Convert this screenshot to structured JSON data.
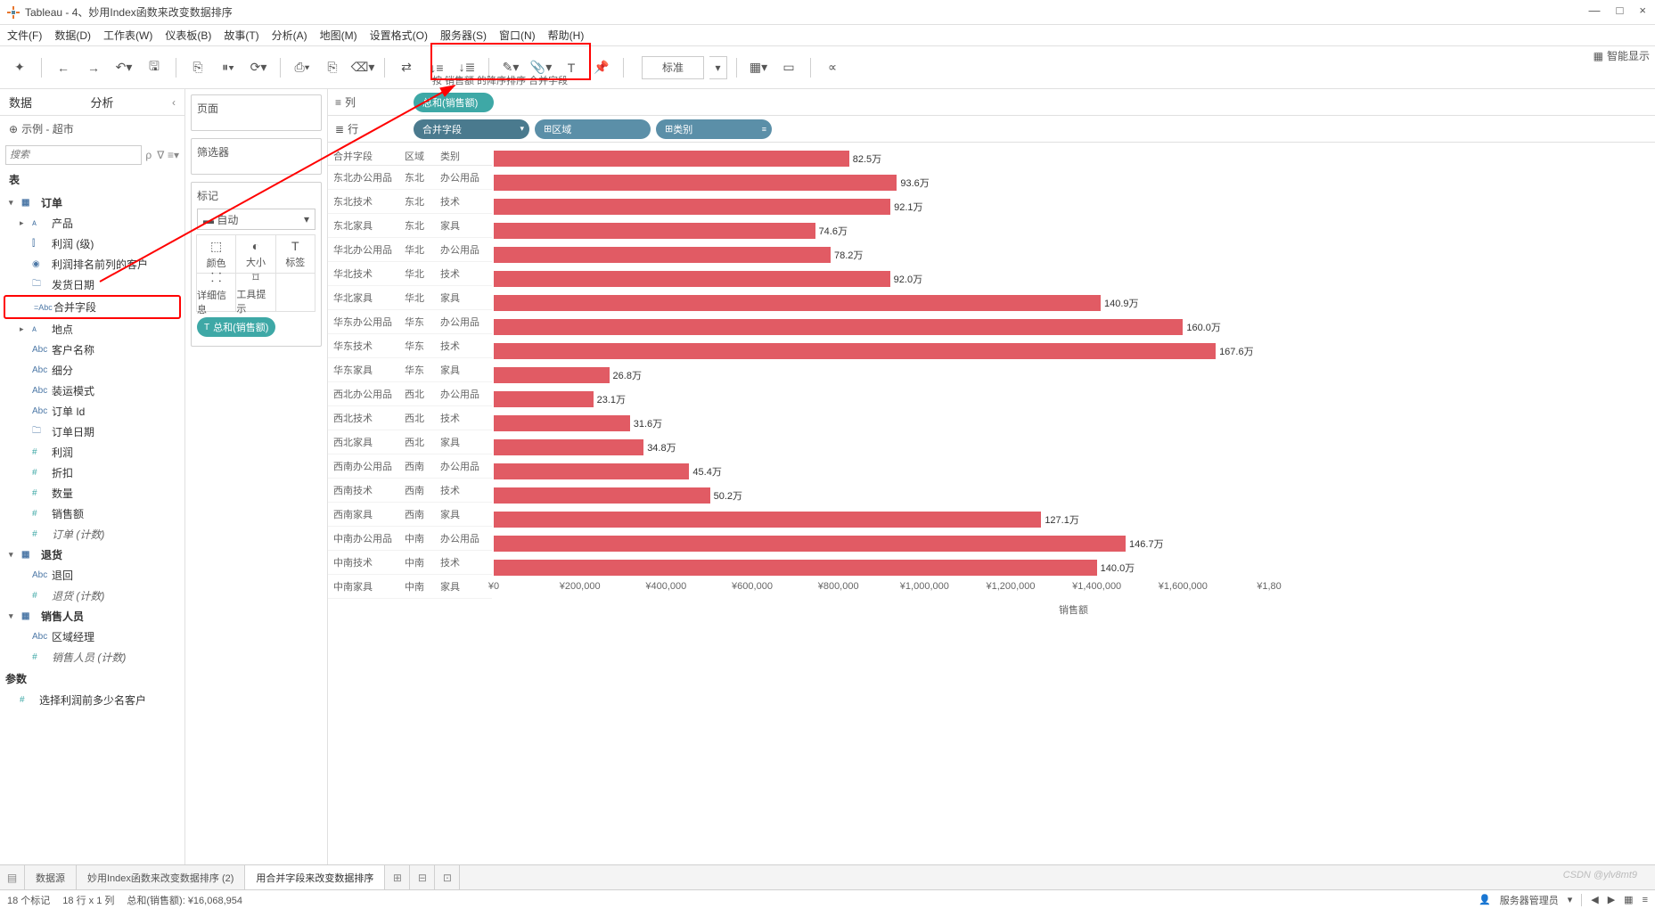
{
  "window": {
    "app": "Tableau",
    "title": "4、妙用Index函数来改变数据排序",
    "min": "—",
    "max": "□",
    "close": "×"
  },
  "menu": [
    "文件(F)",
    "数据(D)",
    "工作表(W)",
    "仪表板(B)",
    "故事(T)",
    "分析(A)",
    "地图(M)",
    "设置格式(O)",
    "服务器(S)",
    "窗口(N)",
    "帮助(H)"
  ],
  "toolbar": {
    "standard": "标准",
    "tooltip": "按 销售额 的降序排序 合并字段",
    "smart": "智能显示"
  },
  "datapane": {
    "tab_data": "数据",
    "tab_analysis": "分析",
    "datasource_icon": "⊕",
    "datasource": "示例 - 超市",
    "search_placeholder": "搜索",
    "section_tables": "表",
    "t_orders": "订单",
    "f_product": "产品",
    "f_profit_bin": "利润 (级)",
    "f_profit_top": "利润排名前列的客户",
    "f_ship_date": "发货日期",
    "f_combined": "合并字段",
    "f_location": "地点",
    "f_customer": "客户名称",
    "f_segment": "细分",
    "f_shipmode": "装运模式",
    "f_orderid": "订单 Id",
    "f_orderdate": "订单日期",
    "m_profit": "利润",
    "m_discount": "折扣",
    "m_quantity": "数量",
    "m_sales": "销售额",
    "m_orders_count": "订单 (计数)",
    "t_returns": "退货",
    "f_return": "退回",
    "m_returns_count": "退货 (计数)",
    "t_salesrep": "销售人员",
    "f_region_mgr": "区域经理",
    "m_salesrep_count": "销售人员 (计数)",
    "section_params": "参数",
    "p_topn": "选择利润前多少名客户"
  },
  "shelves": {
    "pages": "页面",
    "filters": "筛选器",
    "marks": "标记",
    "mark_type": "自动",
    "color": "颜色",
    "size": "大小",
    "label": "标签",
    "detail": "详细信息",
    "tooltip_lbl": "工具提示",
    "pill_sum_sales": "总和(销售额)",
    "columns_lbl": "列",
    "rows_lbl": "行",
    "pill_col": "总和(销售额)",
    "pill_combined": "合并字段",
    "pill_region": "区域",
    "pill_category": "类别"
  },
  "chart_data": {
    "type": "bar",
    "headers": {
      "combined": "合并字段",
      "region": "区域",
      "category": "类别"
    },
    "rows": [
      {
        "combined": "东北办公用品",
        "region": "东北",
        "category": "办公用品",
        "value": 825000,
        "label": "82.5万"
      },
      {
        "combined": "东北技术",
        "region": "东北",
        "category": "技术",
        "value": 936000,
        "label": "93.6万"
      },
      {
        "combined": "东北家具",
        "region": "东北",
        "category": "家具",
        "value": 921000,
        "label": "92.1万"
      },
      {
        "combined": "华北办公用品",
        "region": "华北",
        "category": "办公用品",
        "value": 746000,
        "label": "74.6万"
      },
      {
        "combined": "华北技术",
        "region": "华北",
        "category": "技术",
        "value": 782000,
        "label": "78.2万"
      },
      {
        "combined": "华北家具",
        "region": "华北",
        "category": "家具",
        "value": 920000,
        "label": "92.0万"
      },
      {
        "combined": "华东办公用品",
        "region": "华东",
        "category": "办公用品",
        "value": 1409000,
        "label": "140.9万"
      },
      {
        "combined": "华东技术",
        "region": "华东",
        "category": "技术",
        "value": 1600000,
        "label": "160.0万"
      },
      {
        "combined": "华东家具",
        "region": "华东",
        "category": "家具",
        "value": 1676000,
        "label": "167.6万"
      },
      {
        "combined": "西北办公用品",
        "region": "西北",
        "category": "办公用品",
        "value": 268000,
        "label": "26.8万"
      },
      {
        "combined": "西北技术",
        "region": "西北",
        "category": "技术",
        "value": 231000,
        "label": "23.1万"
      },
      {
        "combined": "西北家具",
        "region": "西北",
        "category": "家具",
        "value": 316000,
        "label": "31.6万"
      },
      {
        "combined": "西南办公用品",
        "region": "西南",
        "category": "办公用品",
        "value": 348000,
        "label": "34.8万"
      },
      {
        "combined": "西南技术",
        "region": "西南",
        "category": "技术",
        "value": 454000,
        "label": "45.4万"
      },
      {
        "combined": "西南家具",
        "region": "西南",
        "category": "家具",
        "value": 502000,
        "label": "50.2万"
      },
      {
        "combined": "中南办公用品",
        "region": "中南",
        "category": "办公用品",
        "value": 1271000,
        "label": "127.1万"
      },
      {
        "combined": "中南技术",
        "region": "中南",
        "category": "技术",
        "value": 1467000,
        "label": "146.7万"
      },
      {
        "combined": "中南家具",
        "region": "中南",
        "category": "家具",
        "value": 1400000,
        "label": "140.0万"
      }
    ],
    "x_ticks": [
      {
        "pos": 0,
        "label": "¥0"
      },
      {
        "pos": 200000,
        "label": "¥200,000"
      },
      {
        "pos": 400000,
        "label": "¥400,000"
      },
      {
        "pos": 600000,
        "label": "¥600,000"
      },
      {
        "pos": 800000,
        "label": "¥800,000"
      },
      {
        "pos": 1000000,
        "label": "¥1,000,000"
      },
      {
        "pos": 1200000,
        "label": "¥1,200,000"
      },
      {
        "pos": 1400000,
        "label": "¥1,400,000"
      },
      {
        "pos": 1600000,
        "label": "¥1,600,000"
      },
      {
        "pos": 1800000,
        "label": "¥1,80"
      }
    ],
    "x_max": 1800000,
    "xlabel": "销售额"
  },
  "tabs": {
    "datasource": "数据源",
    "sheet1": "妙用Index函数来改变数据排序 (2)",
    "sheet2": "用合并字段来改变数据排序"
  },
  "status": {
    "marks": "18 个标记",
    "rxc": "18 行 x 1 列",
    "sum": "总和(销售额): ¥16,068,954",
    "server_admin": "服务器管理员"
  },
  "watermark": "CSDN @ylv8mt9"
}
